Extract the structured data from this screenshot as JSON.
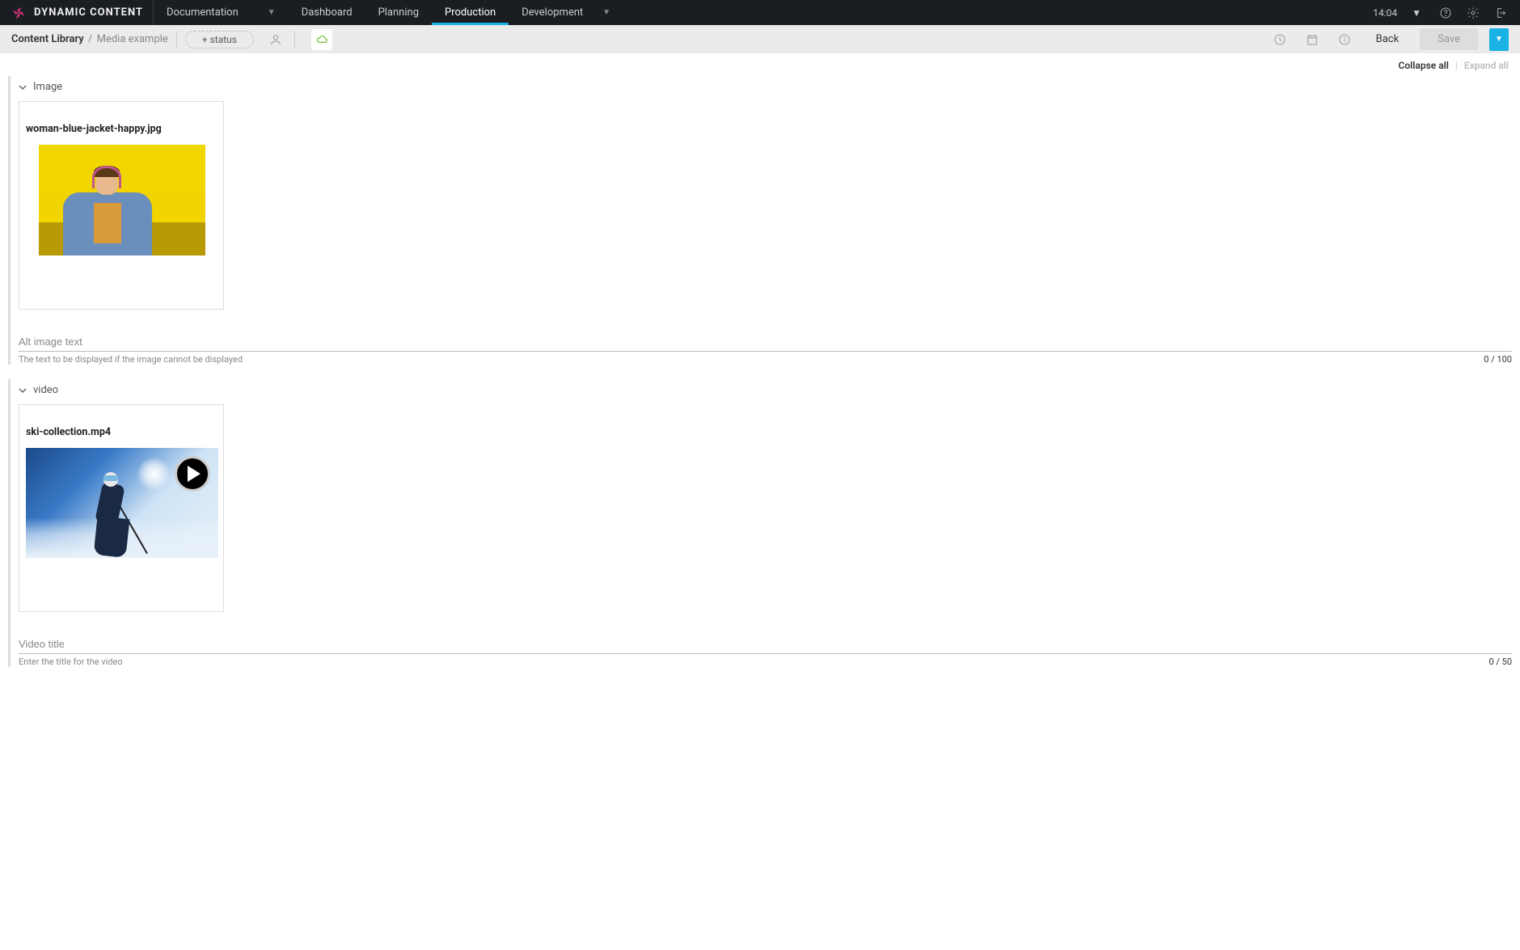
{
  "header": {
    "brand": "DYNAMIC CONTENT",
    "dropdown1": "Documentation",
    "nav": [
      "Dashboard",
      "Planning",
      "Production",
      "Development"
    ],
    "active_nav": "Production",
    "time": "14:04"
  },
  "subbar": {
    "breadcrumb_root": "Content Library",
    "breadcrumb_leaf": "Media example",
    "status_pill": "+ status",
    "back": "Back",
    "save": "Save"
  },
  "collapse": {
    "collapse_all": "Collapse all",
    "expand_all": "Expand all"
  },
  "sections": [
    {
      "title": "Image",
      "media_filename": "woman-blue-jacket-happy.jpg",
      "field_placeholder": "Alt image text",
      "field_help": "The text to be displayed if the image cannot be displayed",
      "field_count": "0 / 100"
    },
    {
      "title": "video",
      "media_filename": "ski-collection.mp4",
      "field_placeholder": "Video title",
      "field_help": "Enter the title for the video",
      "field_count": "0 / 50"
    }
  ]
}
